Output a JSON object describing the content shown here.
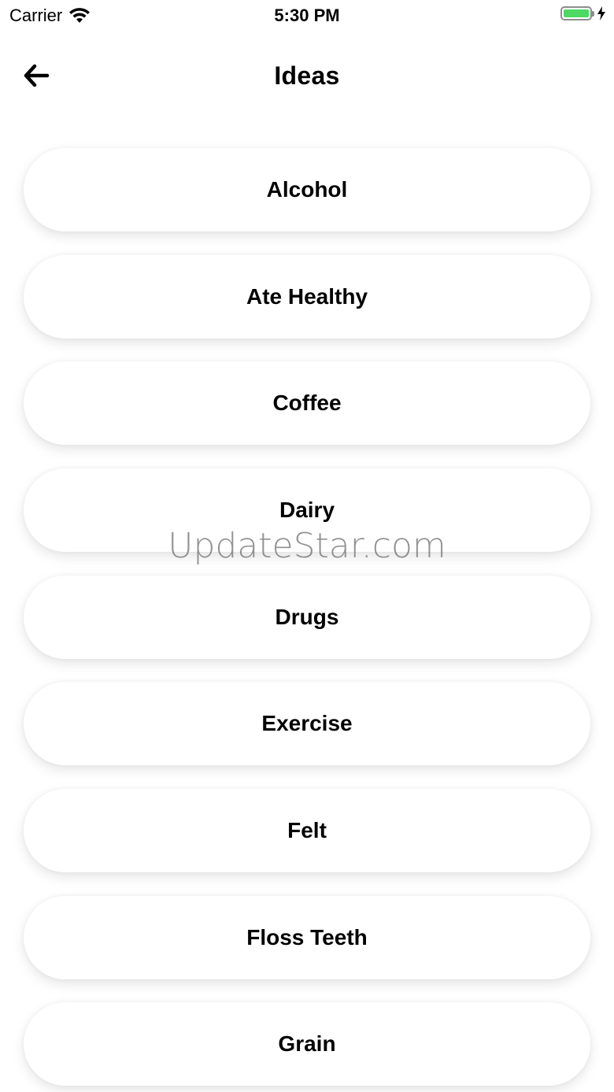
{
  "status_bar": {
    "carrier": "Carrier",
    "time": "5:30 PM",
    "battery_level": 1.0,
    "battery_color": "#4cd964"
  },
  "nav": {
    "back_icon": "arrow-left-icon",
    "title": "Ideas"
  },
  "ideas": [
    {
      "label": "Alcohol"
    },
    {
      "label": "Ate Healthy"
    },
    {
      "label": "Coffee"
    },
    {
      "label": "Dairy"
    },
    {
      "label": "Drugs"
    },
    {
      "label": "Exercise"
    },
    {
      "label": "Felt"
    },
    {
      "label": "Floss Teeth"
    },
    {
      "label": "Grain"
    }
  ],
  "watermark": "UpdateStar.com"
}
